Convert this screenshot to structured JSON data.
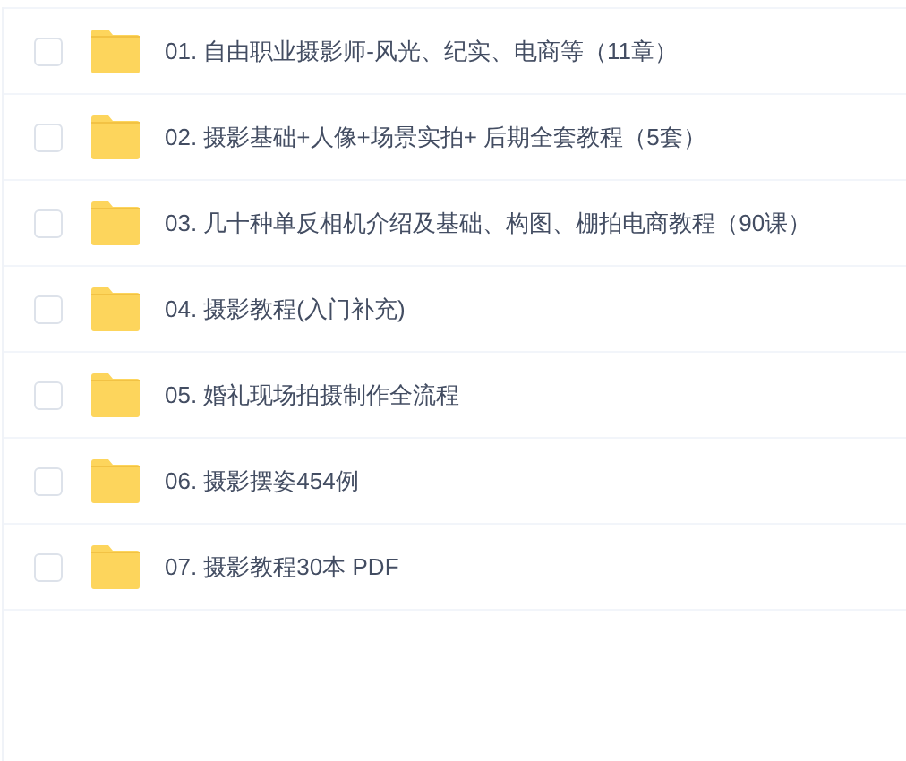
{
  "files": [
    {
      "name": "01. 自由职业摄影师-风光、纪实、电商等（11章）",
      "checked": false
    },
    {
      "name": "02. 摄影基础+人像+场景实拍+ 后期全套教程（5套）",
      "checked": false
    },
    {
      "name": "03. 几十种单反相机介绍及基础、构图、棚拍电商教程（90课）",
      "checked": false
    },
    {
      "name": "04. 摄影教程(入门补充)",
      "checked": false
    },
    {
      "name": "05. 婚礼现场拍摄制作全流程",
      "checked": false
    },
    {
      "name": "06. 摄影摆姿454例",
      "checked": false
    },
    {
      "name": "07. 摄影教程30本 PDF",
      "checked": false
    }
  ]
}
